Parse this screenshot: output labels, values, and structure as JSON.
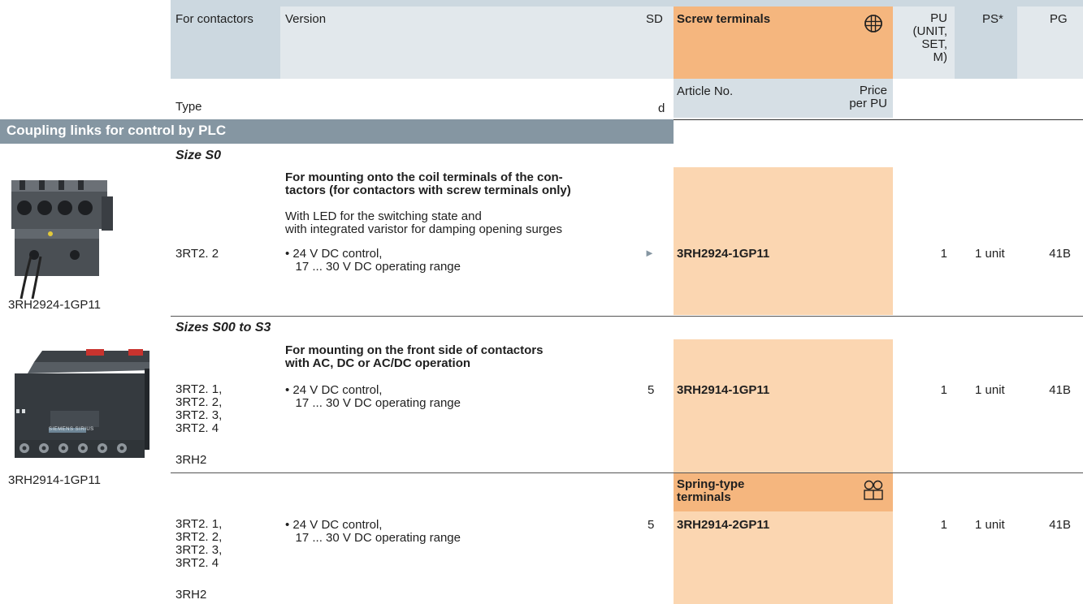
{
  "header": {
    "for_contactors": "For contactors",
    "version": "Version",
    "sd": "SD",
    "screw_terminals": "Screw terminals",
    "pu": "PU\n(UNIT,\nSET,\nM)",
    "ps": "PS*",
    "pg": "PG",
    "type": "Type",
    "d": "d",
    "article_no": "Article No.",
    "price_per_pu": "Price\nper PU"
  },
  "section": {
    "title": "Coupling links for control by PLC"
  },
  "group1": {
    "size": "Size S0",
    "desc_bold": "For mounting onto the coil terminals of the con-\ntactors (for contactors with screw terminals only)",
    "desc_normal": "With LED for the switching state and\nwith integrated varistor for damping opening surges",
    "type": "3RT2. 2",
    "version": "• 24 V DC control,\n   17 ... 30 V DC operating range",
    "sd_marker": "►",
    "article": "3RH2924-1GP11",
    "pu": "1",
    "ps": "1 unit",
    "pg": "41B",
    "photo_caption": "3RH2924-1GP11"
  },
  "group2": {
    "size": "Sizes S00 to S3",
    "desc_bold": "For mounting on the front side of contactors\nwith AC, DC or AC/DC operation",
    "type": "3RT2. 1,\n3RT2. 2,\n3RT2. 3,\n3RT2. 4",
    "type2": "3RH2",
    "version": "• 24 V DC control,\n   17 ... 30 V DC operating range",
    "sd": "5",
    "article": "3RH2914-1GP11",
    "pu": "1",
    "ps": "1 unit",
    "pg": "41B",
    "photo_caption": "3RH2914-1GP11",
    "photo_label": "SIEMENS SIRIUS"
  },
  "group3": {
    "spring_terminals": "Spring-type\nterminals",
    "type": "3RT2. 1,\n3RT2. 2,\n3RT2. 3,\n3RT2. 4",
    "type2": "3RH2",
    "version": "• 24 V DC control,\n   17 ... 30 V DC operating range",
    "sd": "5",
    "article": "3RH2914-2GP11",
    "pu": "1",
    "ps": "1 unit",
    "pg": "41B"
  },
  "colors": {
    "header_band": "#ccd8e0",
    "orange_header": "#f5b67e",
    "orange_light": "#fbd6b1",
    "section_bar": "#8596a2",
    "blue_cell": "#d6dfe5"
  }
}
